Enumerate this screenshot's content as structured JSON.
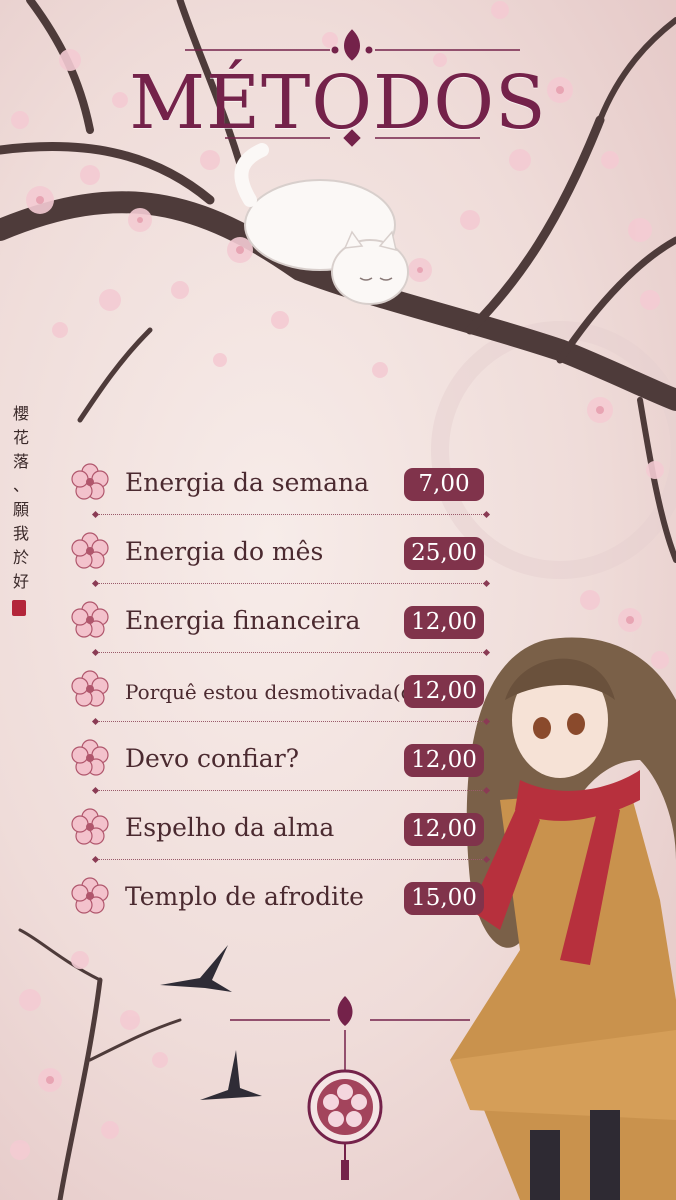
{
  "title": "MÉTODOS",
  "vertical_text": [
    "櫻",
    "花",
    "落",
    "、",
    "願",
    "我",
    "於",
    "好"
  ],
  "menu": [
    {
      "label": "Energia da semana",
      "price": "7,00"
    },
    {
      "label": "Energia do mês",
      "price": "25,00"
    },
    {
      "label": "Energia financeira",
      "price": "12,00"
    },
    {
      "label": "Porquê estou desmotivada(o)",
      "price": "12,00"
    },
    {
      "label": "Devo confiar?",
      "price": "12,00"
    },
    {
      "label": "Espelho da alma",
      "price": "12,00"
    },
    {
      "label": "Templo de afrodite",
      "price": "15,00"
    }
  ],
  "colors": {
    "accent": "#74224a",
    "price_bg": "#80334b",
    "text": "#4b2a30",
    "blossom": "#f2c6cf"
  },
  "decorations": [
    "cherry-blossom-tree",
    "white-cat",
    "swallow-birds",
    "anime-girl-red-scarf",
    "sakura-emblem-ornament"
  ]
}
